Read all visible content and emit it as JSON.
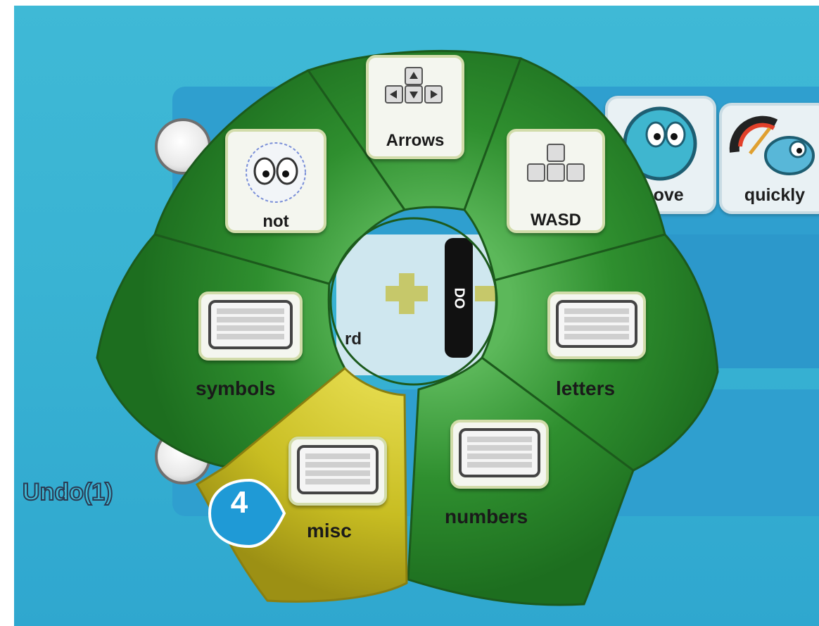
{
  "background": {
    "undo_label": "Undo(1)",
    "tiles": [
      {
        "label": "move",
        "icon": "character-face-icon"
      },
      {
        "label": "quickly",
        "icon": "speedometer-icon"
      }
    ],
    "inner_block": {
      "keyboard_fragment": "rd",
      "do_label": "DO"
    }
  },
  "pie_menu": {
    "segments": [
      {
        "label": "Arrows",
        "icon": "arrow-keys-icon",
        "color": "#2f8f2f"
      },
      {
        "label": "WASD",
        "icon": "wasd-keys-icon",
        "color": "#2f8f2f"
      },
      {
        "label": "letters",
        "icon": "keyboard-icon",
        "color": "#2f8f2f"
      },
      {
        "label": "numbers",
        "icon": "keyboard-icon",
        "color": "#2f8f2f"
      },
      {
        "label": "misc",
        "icon": "keyboard-icon",
        "color": "#c8bd22",
        "highlighted": true
      },
      {
        "label": "symbols",
        "icon": "keyboard-icon",
        "color": "#2f8f2f"
      },
      {
        "label": "not",
        "icon": "eyes-icon",
        "color": "#2f8f2f"
      }
    ]
  },
  "step_badge": {
    "number": "4",
    "color": "#1f9ad6"
  },
  "colors": {
    "stage": "#3fb9d6",
    "segment_green": "#2f8f2f",
    "segment_yellow": "#c8bd22"
  }
}
